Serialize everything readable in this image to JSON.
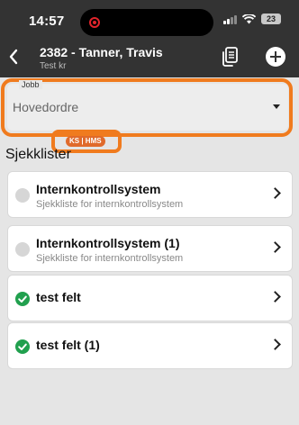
{
  "status_bar": {
    "time": "14:57",
    "battery": "23"
  },
  "header": {
    "title": "2382 - Tanner, Travis",
    "subtitle": "Test kr"
  },
  "job_field": {
    "label": "Jobb",
    "value": "Hovedordre"
  },
  "badge": {
    "label": "KS | HMS"
  },
  "checklists": {
    "heading": "Sjekklister",
    "items": [
      {
        "title": "Internkontrollsystem",
        "subtitle": "Sjekkliste for internkontrollsystem",
        "status": "pending"
      },
      {
        "title": "Internkontrollsystem (1)",
        "subtitle": "Sjekkliste for internkontrollsystem",
        "status": "pending"
      },
      {
        "title": "test felt",
        "subtitle": "",
        "status": "done"
      },
      {
        "title": "test felt (1)",
        "subtitle": "",
        "status": "done"
      }
    ]
  },
  "colors": {
    "header_bg": "#333333",
    "highlight": "#f07b1e",
    "done": "#21a04e",
    "badge": "#e06a2b"
  },
  "icons": {
    "back": "chevron-left-icon",
    "doc": "copy-document-icon",
    "add": "plus-circle-icon"
  }
}
